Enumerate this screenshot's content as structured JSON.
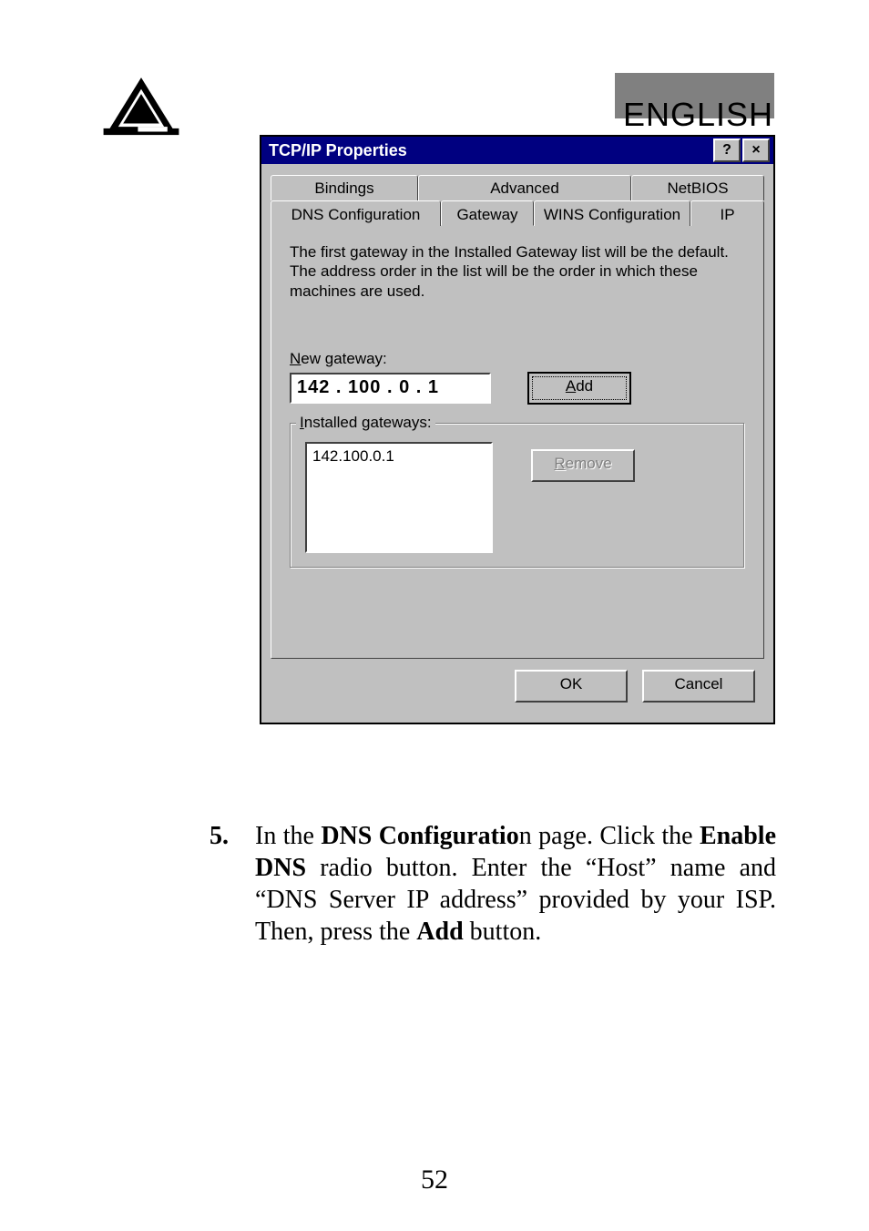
{
  "header": {
    "language_label": "ENGLISH"
  },
  "dialog": {
    "title": "TCP/IP Properties",
    "help_btn": "?",
    "close_btn": "×",
    "tabs_row1": {
      "bindings": "Bindings",
      "advanced": "Advanced",
      "netbios": "NetBIOS"
    },
    "tabs_row2": {
      "dns": "DNS Configuration",
      "gateway": "Gateway",
      "wins": "WINS Configuration",
      "ip": "IP Address"
    },
    "info_text": "The first gateway in the Installed Gateway list will be the default. The address order in the list will be the order in which these machines are used.",
    "new_gateway_label_underline": "N",
    "new_gateway_label_rest": "ew gateway:",
    "new_gateway_value": "142 . 100 .  0  .  1",
    "add_underline": "A",
    "add_rest": "dd",
    "installed_label_underline": "I",
    "installed_label_rest": "nstalled gateways:",
    "installed_list": [
      "142.100.0.1"
    ],
    "remove_underline": "R",
    "remove_rest": "emove",
    "ok": "OK",
    "cancel": "Cancel"
  },
  "paragraph": {
    "number": "5.",
    "t1": "In the ",
    "b1": "DNS Configuratio",
    "t2": "n page. Click the ",
    "b2": "Enable DNS",
    "t3": " radio button. Enter the “Host” name and “DNS Server IP address” provided by your ISP. Then, press the ",
    "b3": "Add",
    "t4": " button."
  },
  "page_number": "52"
}
